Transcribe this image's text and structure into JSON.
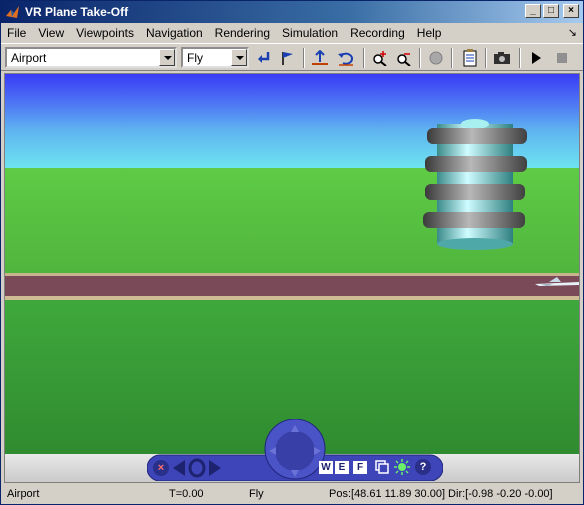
{
  "window": {
    "title": "VR Plane Take-Off",
    "minimize_label": "_",
    "maximize_label": "□",
    "close_label": "×"
  },
  "menubar": {
    "items": [
      "File",
      "View",
      "Viewpoints",
      "Navigation",
      "Rendering",
      "Simulation",
      "Recording",
      "Help"
    ],
    "dock_glyph": "↘"
  },
  "toolbar": {
    "viewpoint_value": "Airport",
    "navmode_value": "Fly",
    "icons": [
      "return-to-viewpoint-icon",
      "create-viewpoint-icon",
      "straighten-up-icon",
      "undo-move-icon",
      "zoom-in-icon",
      "zoom-out-icon",
      "headlight-icon",
      "edit-virtual-world-icon",
      "capture-frame-icon",
      "play-icon",
      "stop-icon"
    ]
  },
  "navpanel": {
    "w_label": "W",
    "e_label": "E",
    "f_label": "F",
    "help_label": "?",
    "close_label": "×"
  },
  "statusbar": {
    "viewpoint": "Airport",
    "time": "T=0.00",
    "mode": "Fly",
    "position": "Pos:[48.61 11.89 30.00] Dir:[-0.98 -0.20 -0.00]"
  },
  "colors": {
    "titlebar_start": "#0a246a",
    "titlebar_end": "#a6caf0",
    "nav_blue": "#3d45b8"
  }
}
